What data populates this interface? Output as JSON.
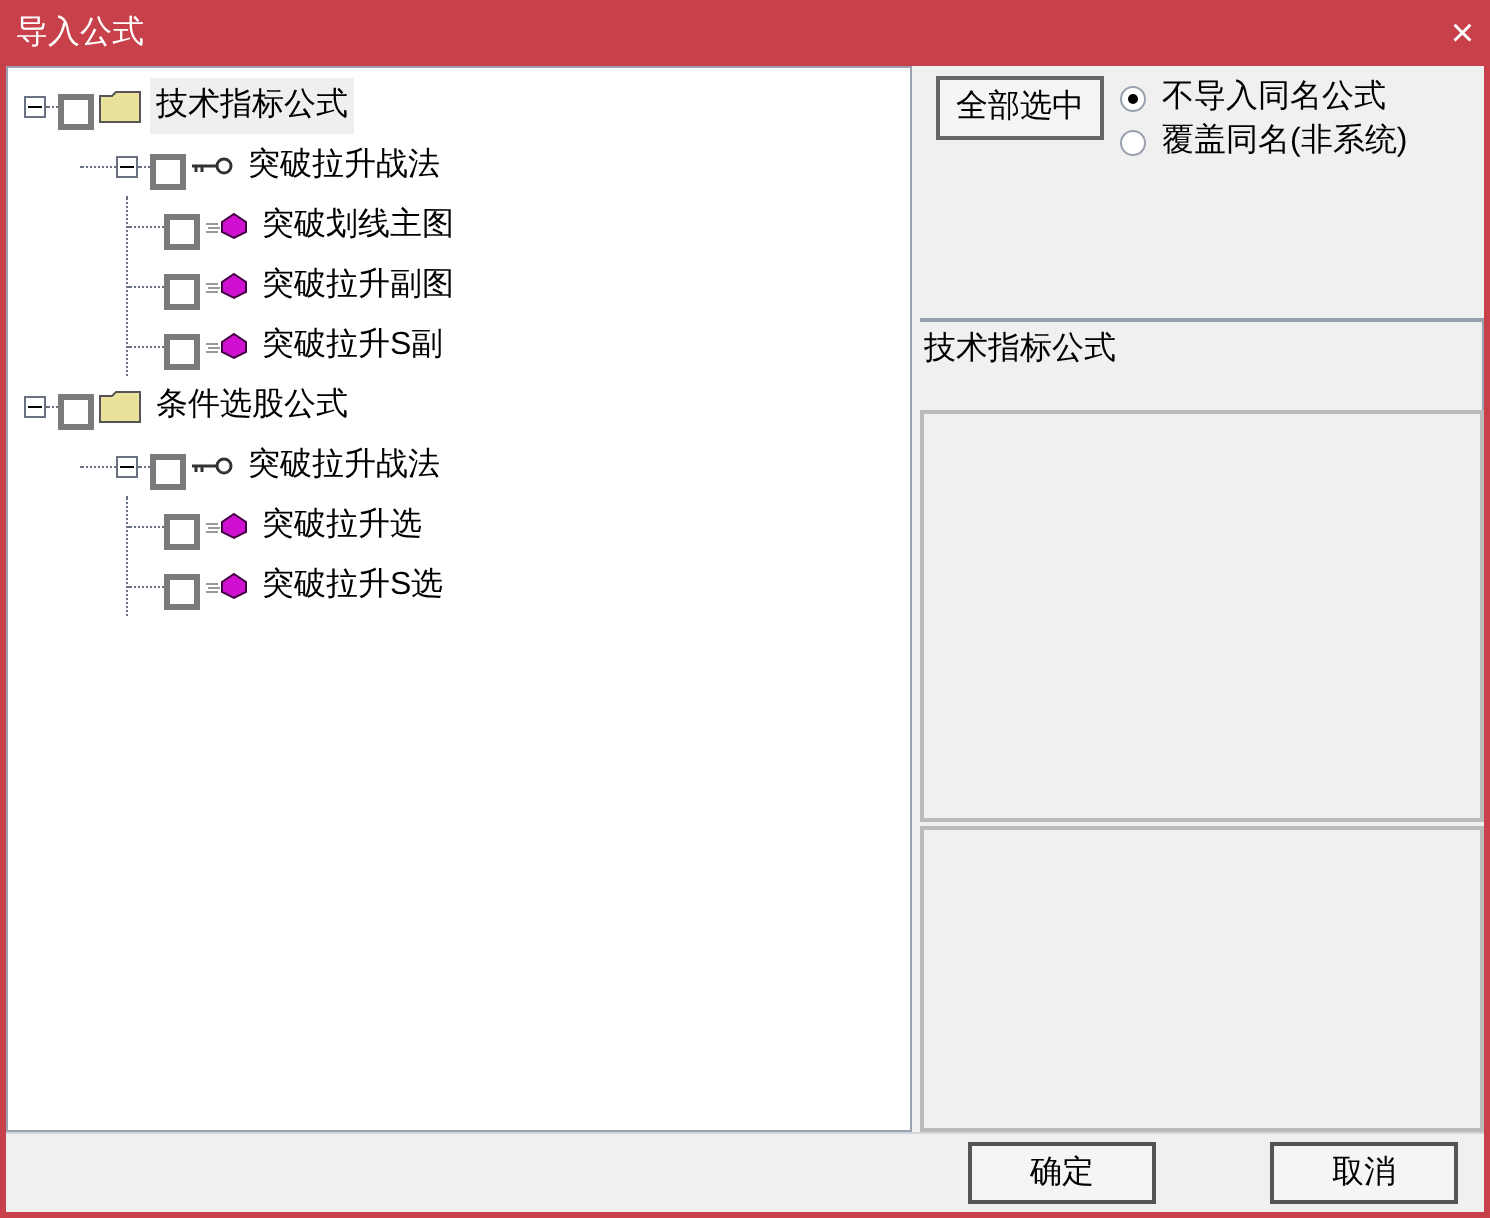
{
  "window": {
    "title": "导入公式",
    "close": "×"
  },
  "tree": [
    {
      "label": "技术指标公式",
      "kind": "folder",
      "selected": true,
      "checked": false,
      "expanded": true,
      "children": [
        {
          "label": "突破拉升战法",
          "kind": "group",
          "selected": false,
          "checked": false,
          "expanded": true,
          "children": [
            {
              "label": "突破划线主图",
              "kind": "formula",
              "selected": false,
              "checked": false
            },
            {
              "label": "突破拉升副图",
              "kind": "formula",
              "selected": false,
              "checked": false
            },
            {
              "label": "突破拉升S副",
              "kind": "formula",
              "selected": false,
              "checked": false
            }
          ]
        }
      ]
    },
    {
      "label": "条件选股公式",
      "kind": "folder",
      "selected": false,
      "checked": false,
      "expanded": true,
      "children": [
        {
          "label": "突破拉升战法",
          "kind": "group",
          "selected": false,
          "checked": false,
          "expanded": true,
          "children": [
            {
              "label": "突破拉升选",
              "kind": "formula",
              "selected": false,
              "checked": false
            },
            {
              "label": "突破拉升S选",
              "kind": "formula",
              "selected": false,
              "checked": false
            }
          ]
        }
      ]
    }
  ],
  "select_all_button": "全部选中",
  "options": [
    {
      "label": "不导入同名公式",
      "selected": true
    },
    {
      "label": "覆盖同名(非系统)",
      "selected": false
    }
  ],
  "info_text": "技术指标公式",
  "buttons": [
    "确定",
    "取消"
  ]
}
